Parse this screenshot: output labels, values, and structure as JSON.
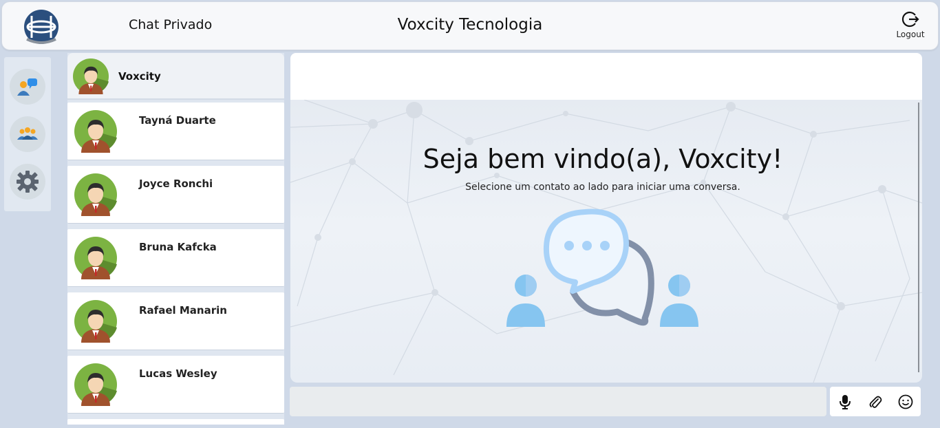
{
  "header": {
    "section_title": "Chat Privado",
    "company_title": "Voxcity Tecnologia",
    "logout_label": "Logout",
    "logo_icon": "globe-logo-icon",
    "logout_icon": "logout-icon"
  },
  "rail": {
    "items": [
      {
        "icon": "chat-users-icon"
      },
      {
        "icon": "group-icon"
      },
      {
        "icon": "gear-icon"
      }
    ]
  },
  "current_user": {
    "name": "Voxcity",
    "avatar_icon": "avatar-icon"
  },
  "contacts": [
    {
      "name": "Tayná Duarte"
    },
    {
      "name": "Joyce Ronchi"
    },
    {
      "name": "Bruna Kafcka"
    },
    {
      "name": "Rafael Manarin"
    },
    {
      "name": "Lucas Wesley"
    }
  ],
  "welcome": {
    "title": "Seja bem vindo(a), Voxcity!",
    "subtitle": "Selecione um contato ao lado para iniciar uma conversa."
  },
  "composer": {
    "value": "",
    "tools": [
      "microphone-icon",
      "paperclip-icon",
      "emoji-icon"
    ]
  },
  "colors": {
    "page_bg": "#cfd9e8",
    "logo_blue": "#2b4f7e",
    "bubble_light": "#a8d2f8",
    "bubble_dark": "#8290a8",
    "person_blue": "#86c5f0"
  }
}
